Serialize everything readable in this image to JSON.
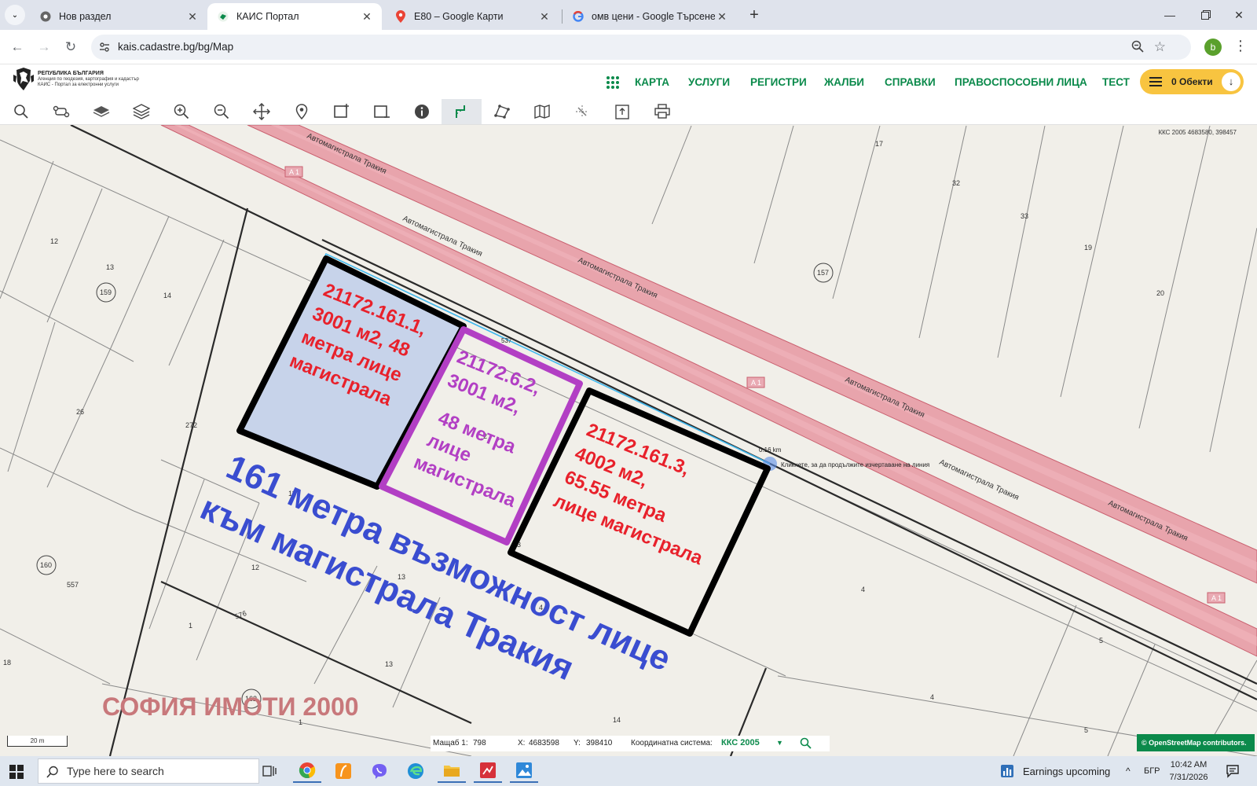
{
  "browser": {
    "tabs": [
      {
        "title": "Нов раздел",
        "active": false
      },
      {
        "title": "КАИС Портал",
        "active": true
      },
      {
        "title": "E80 – Google Карти",
        "active": false
      },
      {
        "title": "омв цени - Google Търсене",
        "active": false
      }
    ],
    "url": "kais.cadastre.bg/bg/Map",
    "profile_initial": "b"
  },
  "site": {
    "logo": {
      "line1": "РЕПУБЛИКА БЪЛГАРИЯ",
      "line2": "Агенция по геодезия, картография и кадастър",
      "line3": "КАИС - Портал за електронни услуги"
    },
    "nav": [
      "КАРТА",
      "УСЛУГИ",
      "РЕГИСТРИ",
      "ЖАЛБИ",
      "СПРАВКИ",
      "ПРАВОСПОСОБНИ ЛИЦА",
      "ТЕСТ"
    ],
    "cart_label": "0 Обекти"
  },
  "tools": [
    "search",
    "route",
    "layer",
    "layers",
    "zoom-in",
    "zoom-out",
    "pan",
    "location",
    "select-rect",
    "deselect-rect",
    "info",
    "measure-line",
    "measure-area",
    "map",
    "split",
    "export",
    "print"
  ],
  "map": {
    "coord_readout": "ККС 2005 4683580, 398457",
    "road_label": "Автомагистрала Тракия",
    "road_badge": "A 1",
    "measure_distance": "0.16 km",
    "measure_hint": "Кликнете, за да продължите изчертаване на линия",
    "measure_small": "537",
    "parcel_numbers": [
      "17",
      "32",
      "33",
      "19",
      "20",
      "12",
      "13",
      "14",
      "26",
      "272",
      "1",
      "2",
      "3",
      "12",
      "13",
      "1",
      "4",
      "5",
      "4",
      "5",
      "18",
      "557",
      "576",
      "13",
      "14",
      "1",
      "11",
      "4"
    ],
    "circled_numbers": [
      "157",
      "159",
      "160",
      "162"
    ],
    "annotations": {
      "parcel1": [
        "21172.161.1,",
        "3001 м2, 48",
        "метра лице",
        "магистрала"
      ],
      "parcel2": [
        "21172.6.2,",
        "3001 м2,",
        "48 метра",
        "лице",
        "магистрала"
      ],
      "parcel3": [
        "21172.161.3,",
        "4002 м2,",
        "65.55 метра",
        "лице магистрала"
      ],
      "blue_line1": "161 метра възможност лице",
      "blue_line2": "към магистрала Тракия",
      "watermark": "СОФИЯ ИМОТИ 2000"
    },
    "scale_bar": "20 m",
    "status": {
      "scale_label": "Мащаб 1:",
      "scale_value": "798",
      "x_label": "X:",
      "x_value": "4683598",
      "y_label": "Y:",
      "y_value": "398410",
      "crs_label": "Координатна система:",
      "crs_value": "ККС 2005"
    },
    "attribution": "© OpenStreetMap contributors."
  },
  "taskbar": {
    "search_placeholder": "Type here to search",
    "weather_text": "Earnings upcoming",
    "lang": "БГР",
    "time": "10:42 AM",
    "date": "7/31/2026"
  },
  "colors": {
    "accent_green": "#0b8a4b",
    "highway": "#e48b97",
    "parcel_red": "#e8212b",
    "parcel_purple": "#b23fc4",
    "blue_text": "#3a4dd0",
    "watermark": "#c8787b"
  }
}
